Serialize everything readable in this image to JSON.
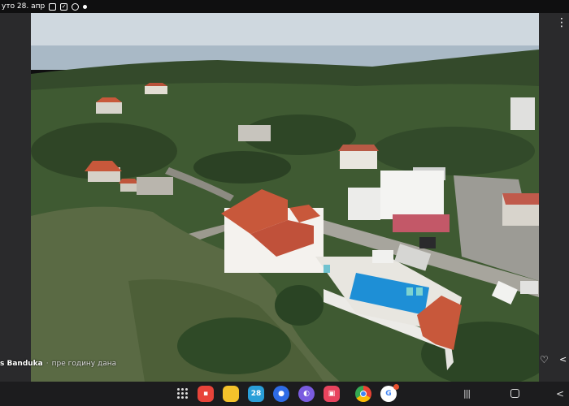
{
  "status_bar": {
    "date_text": "уто 28. апр"
  },
  "caption": {
    "author": "s Banduka",
    "separator": "·",
    "age": "пре годину дана"
  },
  "taskbar": {
    "calendar_day": "28",
    "apps": [
      {
        "name": "flipboard",
        "color": "#e8443a"
      },
      {
        "name": "notes",
        "color": "#f4c22b"
      },
      {
        "name": "calendar",
        "color": "#2a9fd8"
      },
      {
        "name": "messages",
        "color": "#2e6ce6"
      },
      {
        "name": "internet",
        "color": "#7a5ce0"
      },
      {
        "name": "screen-recorder",
        "color": "#e8445e"
      },
      {
        "name": "chrome",
        "color": "#ffffff"
      },
      {
        "name": "google",
        "color": "#ffffff"
      }
    ]
  },
  "colors": {
    "sky": "#cfd8df",
    "sea": "#8fa6b8",
    "vegetation": "#3f5a32",
    "roof": "#c8583b",
    "pool": "#1e8fd6"
  }
}
